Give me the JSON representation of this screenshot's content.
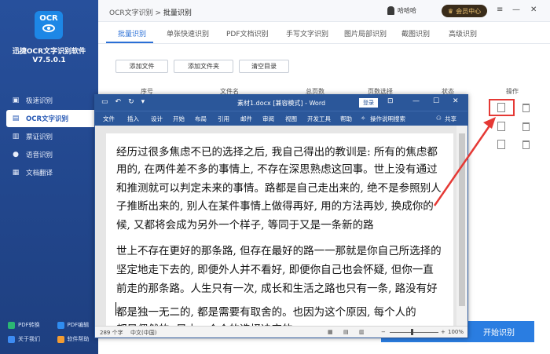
{
  "app": {
    "logo_text": "OCR",
    "name": "迅捷OCR文字识别软件",
    "version": "V7.5.0.1"
  },
  "nav": [
    {
      "label": "极速识别",
      "icon": "image-icon"
    },
    {
      "label": "OCR文字识别",
      "icon": "ocr-icon"
    },
    {
      "label": "票证识别",
      "icon": "ticket-icon"
    },
    {
      "label": "语音识别",
      "icon": "microphone-icon"
    },
    {
      "label": "文档翻译",
      "icon": "translate-icon"
    }
  ],
  "footer_tools": [
    {
      "label": "PDF转换",
      "color": "#2bb673"
    },
    {
      "label": "PDF编辑",
      "color": "#2f8cf0"
    },
    {
      "label": "关于我们",
      "color": "#3d8bf2"
    },
    {
      "label": "软件帮助",
      "color": "#f39c32"
    }
  ],
  "topbar": {
    "crumb_root": "OCR文字识别",
    "crumb_sep": ">",
    "crumb_current": "批量识别",
    "username": "哈哈哈",
    "vip_label": "会员中心"
  },
  "tabs": [
    "批量识别",
    "单张快速识别",
    "PDF文档识别",
    "手写文字识别",
    "图片局部识别",
    "截图识别",
    "高级识别"
  ],
  "actions": {
    "add_file": "添加文件",
    "add_folder": "添加文件夹",
    "clear": "清空目录"
  },
  "table_headers": [
    "序号",
    "文件名",
    "总页数",
    "页数选择",
    "状态",
    "操作"
  ],
  "start_button": "开始识别",
  "word": {
    "title": "素材1.docx [兼容模式] - Word",
    "login": "登录",
    "quick_access": [
      "save-icon",
      "undo-icon",
      "redo-icon"
    ],
    "ribbon": [
      "文件",
      "插入",
      "设计",
      "开始",
      "布局",
      "引用",
      "邮件",
      "审阅",
      "视图",
      "开发工具",
      "帮助",
      "操作说明搜索",
      "共享"
    ],
    "lines": [
      "经历过很多焦虑不已的选择之后, 我自己得出的教训是: 所有的焦虑都",
      "用的, 在两件差不多的事情上, 不存在深思熟虑这回事。世上没有通过",
      "和推测就可以判定未来的事情。路都是自己走出来的, 绝不是参照别人",
      "子推断出来的, 别人在某件事情上做得再好, 用的方法再妙, 换成你的",
      "候, 又都将会成为另外一个样子, 等同于又是一条新的路",
      "世上不存在更好的那条路, 但存在最好的路一一那就是你自己所选择的",
      "坚定地走下去的, 即便外人并不看好, 即便你自己也会怀疑, 但你一直",
      "前走的那条路。人生只有一次, 成长和生活之路也只有一条, 路没有好",
      "都是独一无二的, 都是需要有取舍的。也因为这个原因, 每个人的",
      "都是偶然的, 是由一个个的选择决定的。"
    ],
    "status": {
      "words": "289 个字",
      "lang": "中文(中国)",
      "zoom": "100%"
    }
  }
}
